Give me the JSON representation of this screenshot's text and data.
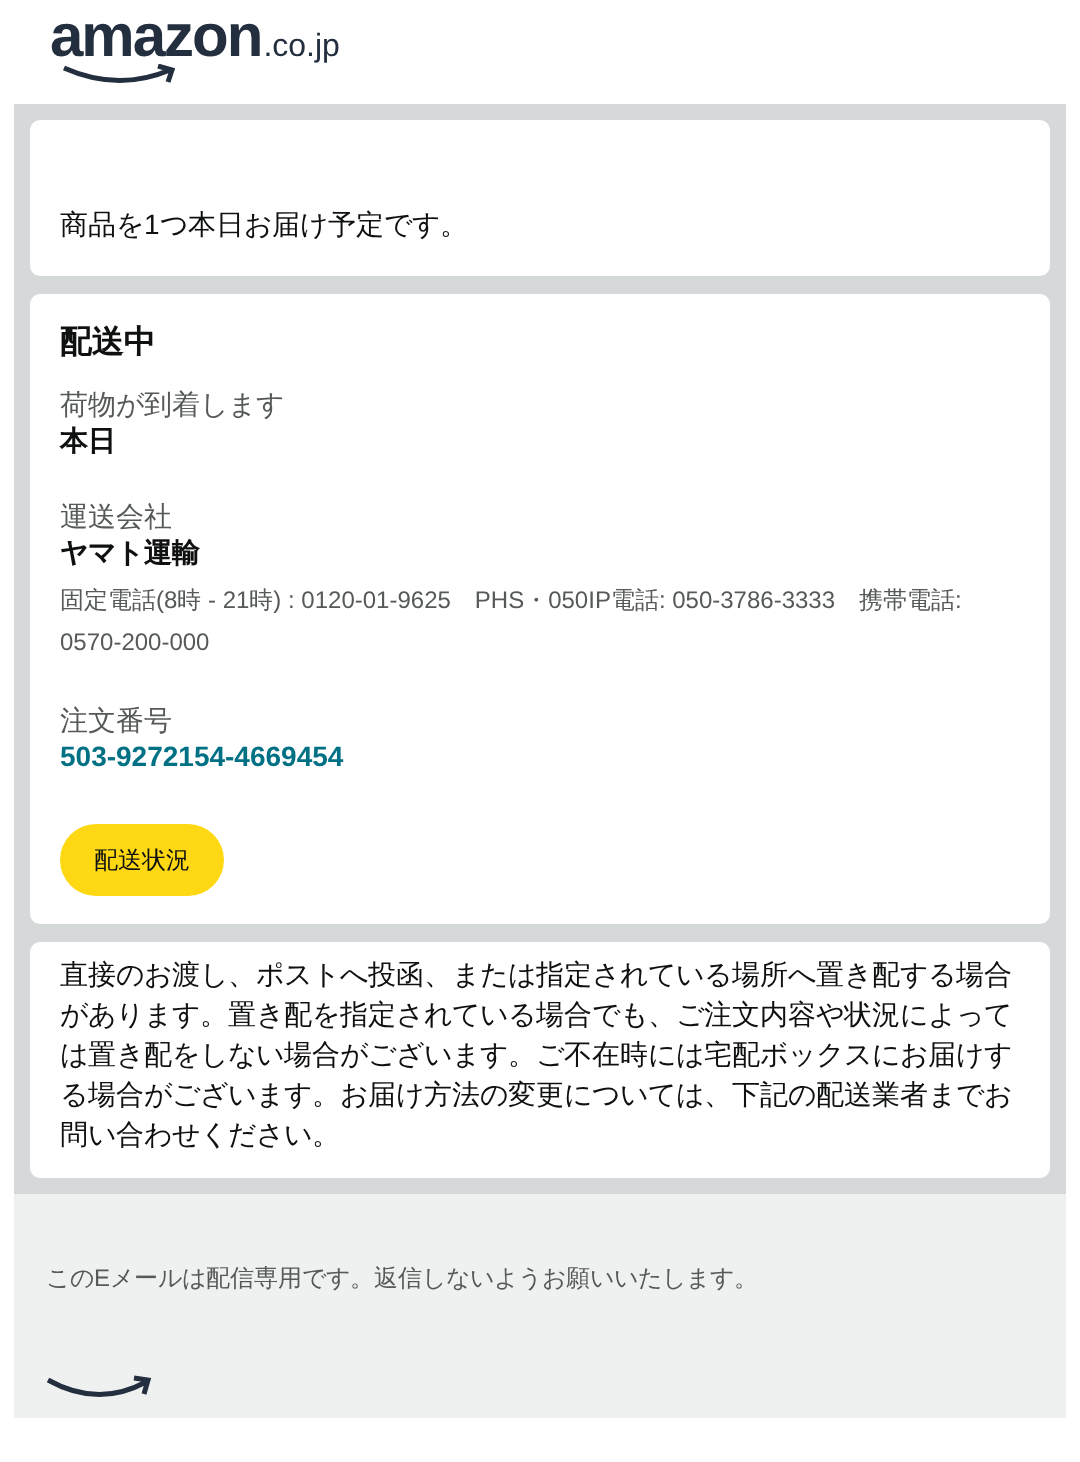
{
  "logo": {
    "wordmark": "amazon",
    "domain": ".co.jp"
  },
  "summary": {
    "text": "商品を1つ本日お届け予定です。"
  },
  "shipment": {
    "status": "配送中",
    "fields": [
      {
        "label": "荷物が到着します",
        "value": "本日",
        "kind": "plain"
      },
      {
        "label": "運送会社",
        "value": "ヤマト運輸",
        "kind": "plain",
        "note": "固定電話(8時 - 21時) : 0120-01-9625　PHS・050IP電話: 050-3786-3333　携帯電話: 0570-200-000"
      },
      {
        "label": "注文番号",
        "value": "503-9272154-4669454",
        "kind": "link"
      }
    ],
    "button": "配送状況"
  },
  "notice": {
    "text": "直接のお渡し、ポストへ投函、または指定されている場所へ置き配する場合があります。置き配を指定されている場合でも、ご注文内容や状況によっては置き配をしない場合がございます。ご不在時には宅配ボックスにお届けする場合がございます。お届け方法の変更については、下記の配送業者までお問い合わせください。"
  },
  "footer": {
    "text": "このEメールは配信専用です。返信しないようお願いいたします。"
  }
}
